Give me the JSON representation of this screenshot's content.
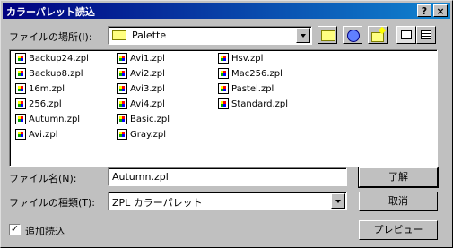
{
  "window": {
    "title": "カラーパレット読込",
    "help_glyph": "?",
    "close_glyph": "×"
  },
  "location": {
    "label": "ファイルの場所(I):",
    "value": "Palette"
  },
  "files": [
    [
      "Backup24.zpl",
      "Backup8.zpl",
      "16m.zpl",
      "256.zpl",
      "Autumn.zpl",
      "Avi.zpl"
    ],
    [
      "Avi1.zpl",
      "Avi2.zpl",
      "Avi3.zpl",
      "Avi4.zpl",
      "Basic.zpl",
      "Gray.zpl"
    ],
    [
      "Hsv.zpl",
      "Mac256.zpl",
      "Pastel.zpl",
      "Standard.zpl"
    ]
  ],
  "filename": {
    "label": "ファイル名(N):",
    "value": "Autumn.zpl"
  },
  "filetype": {
    "label": "ファイルの種類(T):",
    "value": "ZPL カラーパレット"
  },
  "checkbox": {
    "label": "追加読込",
    "checked": true
  },
  "buttons": {
    "ok": "了解",
    "cancel": "取消",
    "preview": "プレビュー"
  }
}
